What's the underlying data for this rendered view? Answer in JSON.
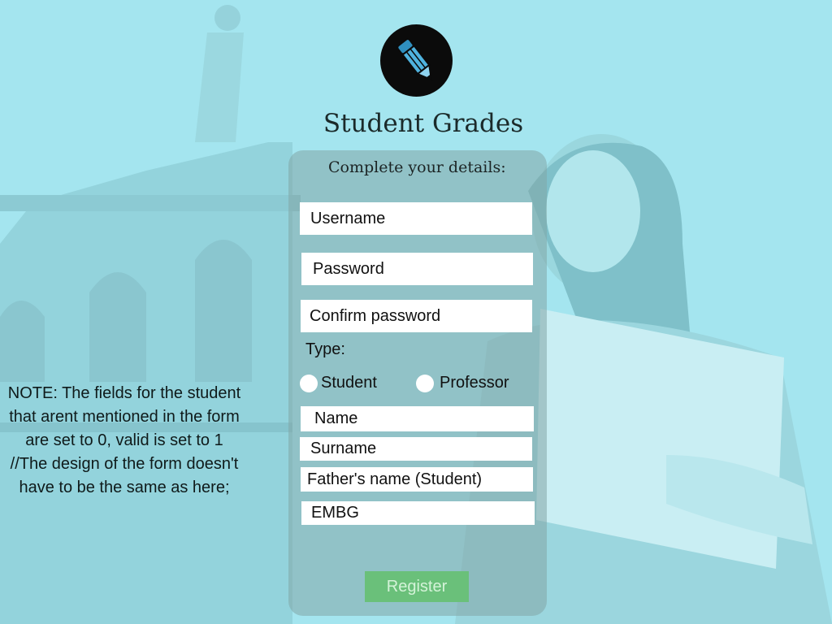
{
  "colors": {
    "background": "#a4e5ef",
    "panel": "#82a5a5",
    "field": "#ffffff",
    "register_button": "#6ac07a",
    "logo_circle": "#0b0b0b",
    "pencil": "#4fb3df"
  },
  "logo": {
    "icon": "pencil-icon"
  },
  "app": {
    "title": "Student Grades"
  },
  "form": {
    "subtitle": "Complete your details:",
    "username_placeholder": "Username",
    "password_placeholder": "Password",
    "confirm_password_placeholder": "Confirm password",
    "type_label": "Type:",
    "type_options": [
      "Student",
      "Professor"
    ],
    "name_placeholder": "Name",
    "surname_placeholder": "Surname",
    "fathers_name_placeholder": "Father's name (Student)",
    "embg_placeholder": "EMBG",
    "register_label": "Register"
  },
  "note": {
    "line1": "NOTE: The fields for the student that arent mentioned in the form are set to 0, valid is set to 1",
    "line2": "//The design of the form doesn't have to be the same as here;"
  }
}
